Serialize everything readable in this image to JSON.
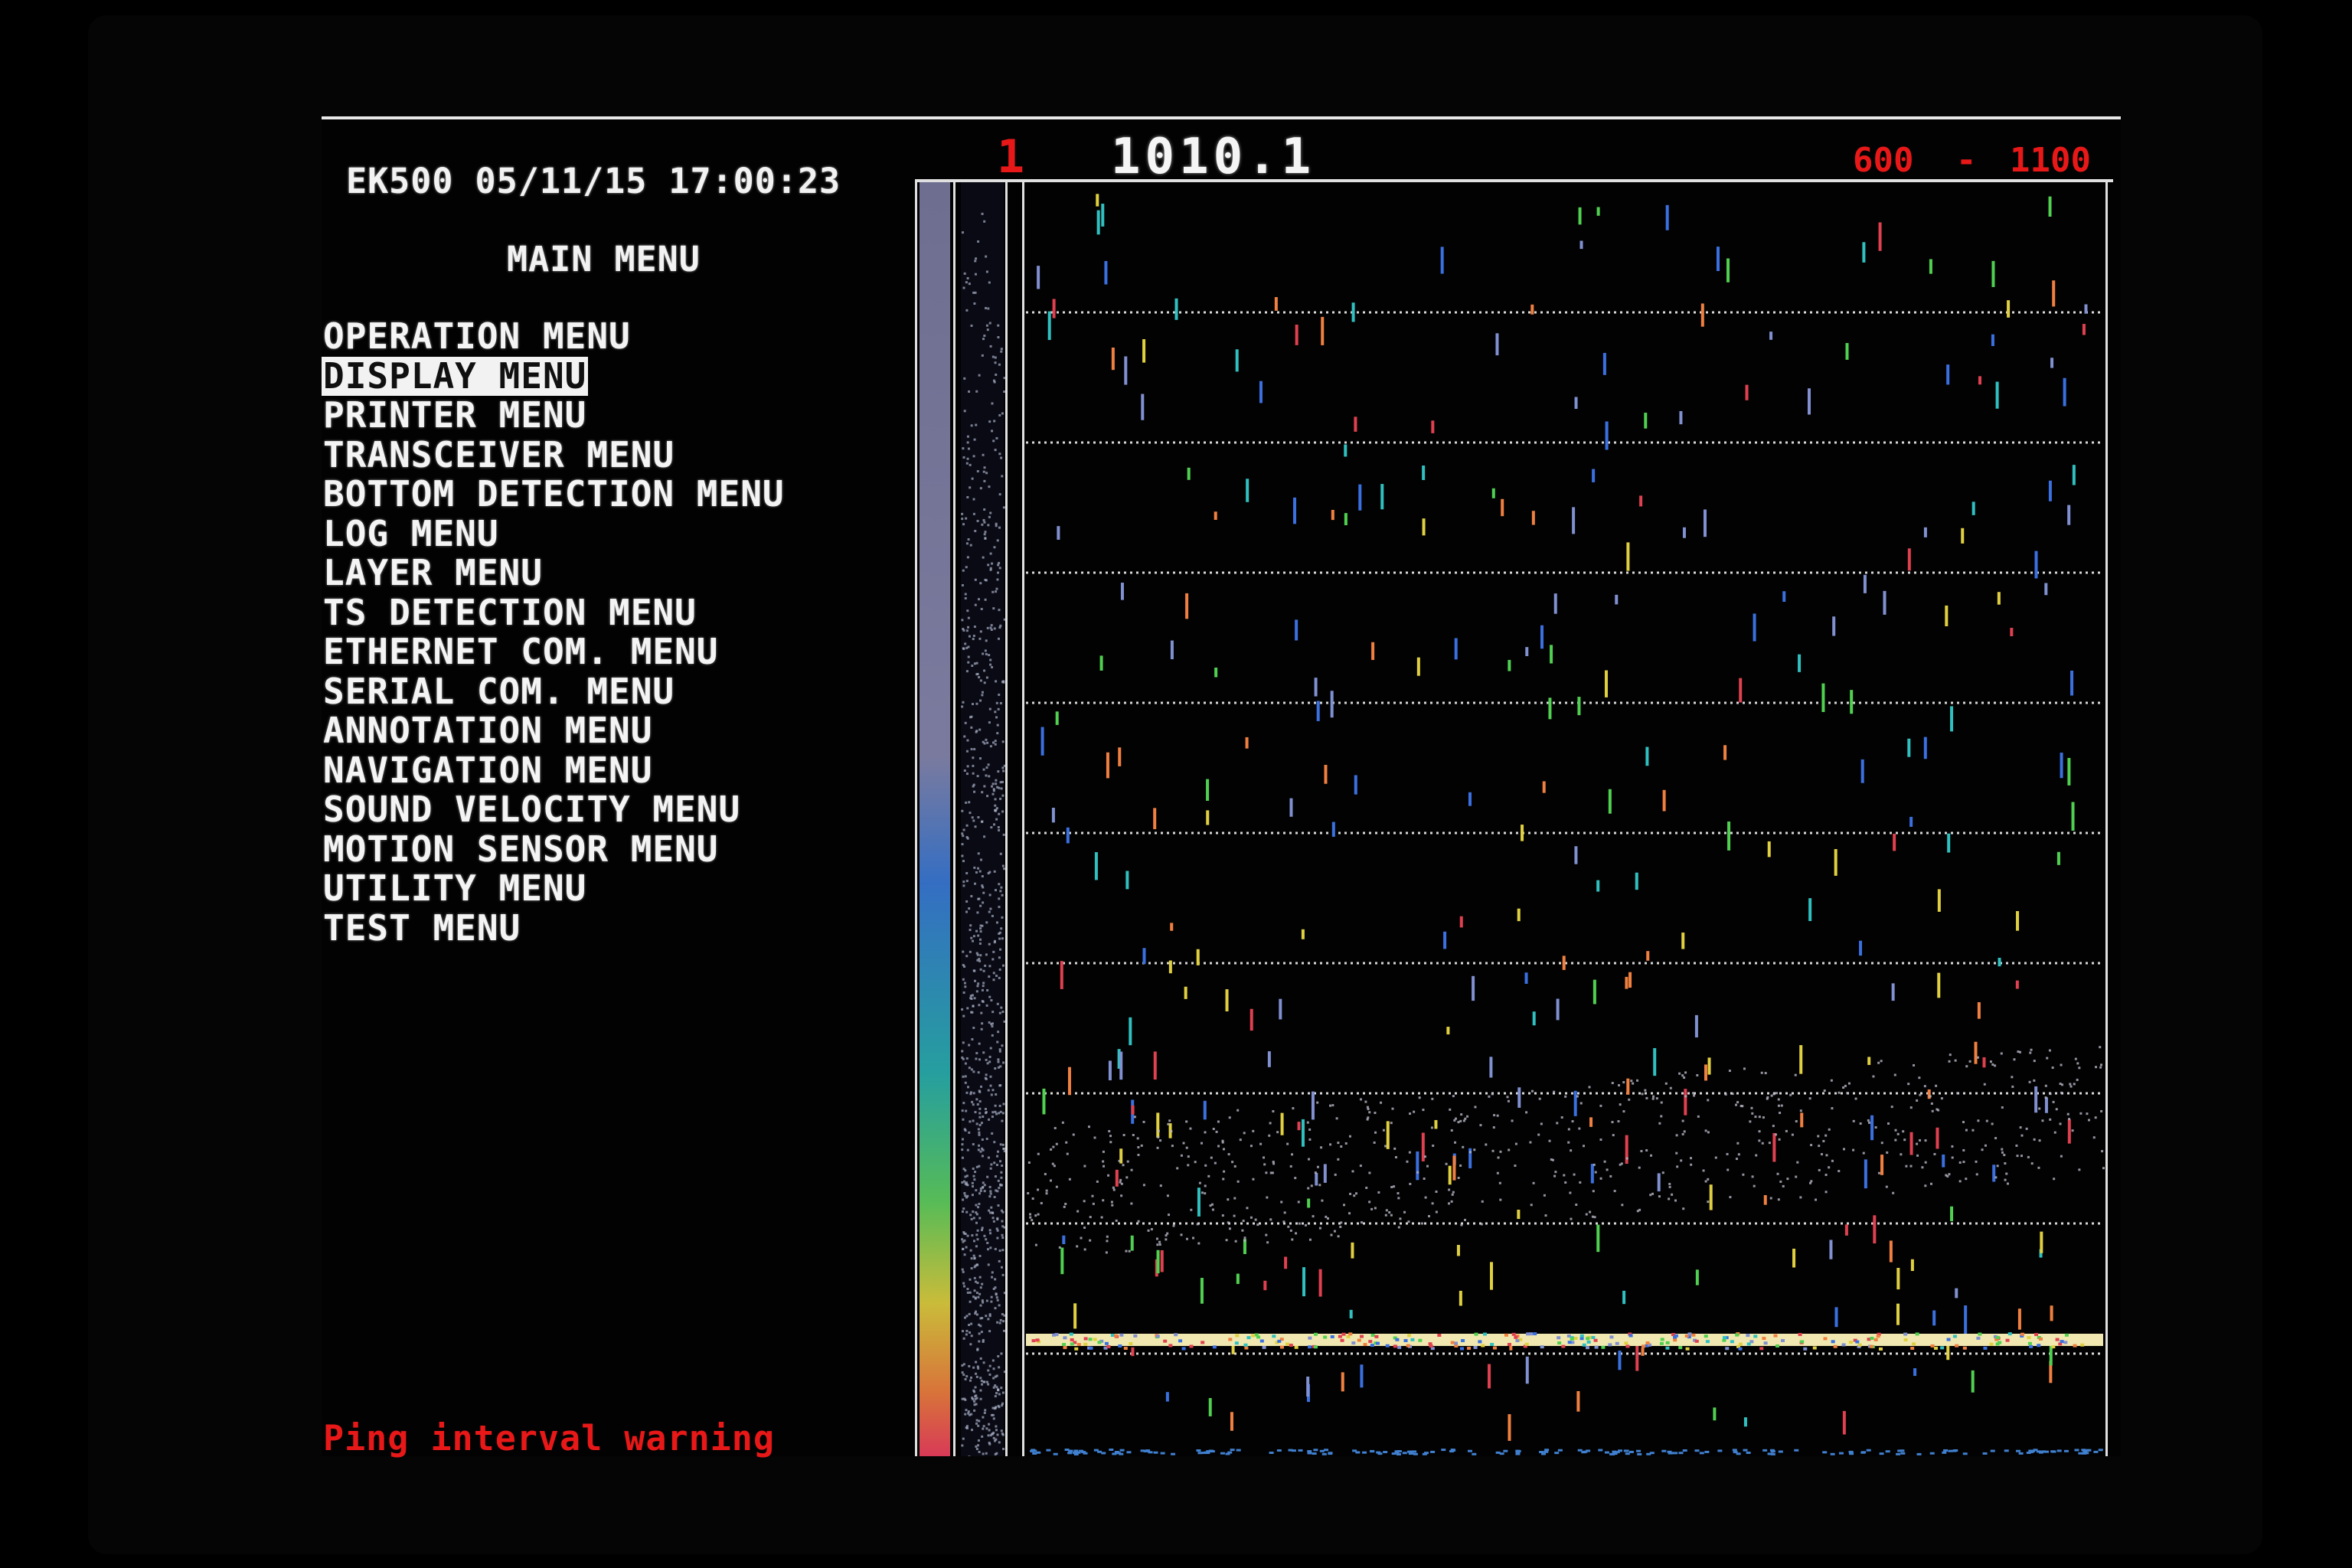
{
  "header": {
    "title": "EK500 05/11/15 17:00:23"
  },
  "main_menu": {
    "title": "MAIN MENU",
    "items": [
      {
        "label": "OPERATION MENU",
        "selected": false
      },
      {
        "label": "DISPLAY MENU",
        "selected": true
      },
      {
        "label": "PRINTER MENU",
        "selected": false
      },
      {
        "label": "TRANSCEIVER MENU",
        "selected": false
      },
      {
        "label": "BOTTOM DETECTION MENU",
        "selected": false
      },
      {
        "label": "LOG MENU",
        "selected": false
      },
      {
        "label": "LAYER MENU",
        "selected": false
      },
      {
        "label": "TS DETECTION MENU",
        "selected": false
      },
      {
        "label": "ETHERNET COM. MENU",
        "selected": false
      },
      {
        "label": "SERIAL COM. MENU",
        "selected": false
      },
      {
        "label": "ANNOTATION MENU",
        "selected": false
      },
      {
        "label": "NAVIGATION MENU",
        "selected": false
      },
      {
        "label": "SOUND VELOCITY MENU",
        "selected": false
      },
      {
        "label": "MOTION SENSOR MENU",
        "selected": false
      },
      {
        "label": "UTILITY MENU",
        "selected": false
      },
      {
        "label": "TEST MENU",
        "selected": false
      }
    ]
  },
  "status": {
    "warning": "Ping interval warning"
  },
  "echogram": {
    "channel": "1",
    "depth": "1010.1",
    "range_start": "600",
    "range_dash": "-",
    "range_end": "1100",
    "colors": {
      "header_text": "#f5f5f5",
      "warning_red": "#e81818",
      "grid": "#d8d8d8",
      "bottom_echo": "#f0e8b0"
    }
  }
}
